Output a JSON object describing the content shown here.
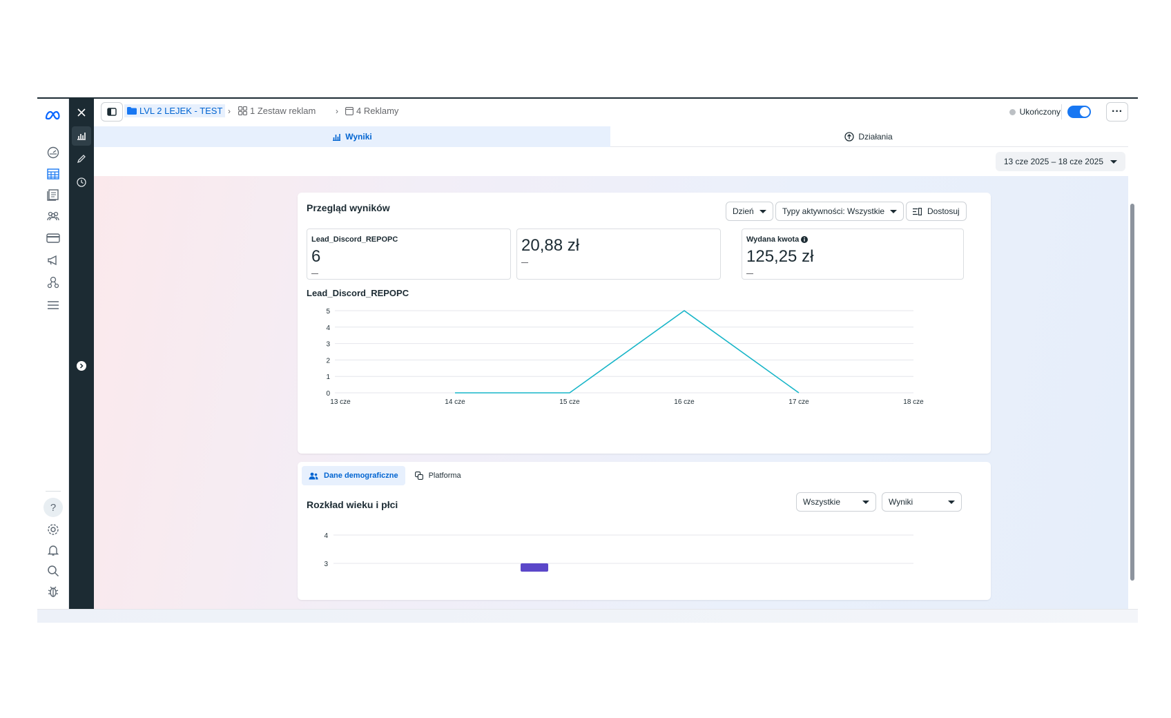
{
  "topbar": {
    "breadcrumbs": [
      {
        "label": "LVL 2 LEJEK - TEST",
        "icon": "folder-icon"
      },
      {
        "label": "1 Zestaw reklam",
        "icon": "grid-icon"
      },
      {
        "label": "4 Reklamy",
        "icon": "ad-icon"
      }
    ],
    "status": "Ukończony",
    "toggle_on": true,
    "more": "···"
  },
  "tabs": [
    {
      "label": "Wyniki",
      "icon": "bar-chart-icon",
      "active": true
    },
    {
      "label": "Działania",
      "icon": "upload-circle-icon",
      "active": false
    }
  ],
  "date_range": "13 cze 2025 – 18 cze 2025",
  "overview": {
    "title": "Przegląd wyników",
    "day_select": "Dzień",
    "activity_select": "Typy aktywności: Wszystkie",
    "customize": "Dostosuj",
    "metrics": [
      {
        "label": "Lead_Discord_REPOPC",
        "value": "6",
        "info": false
      },
      {
        "label": "",
        "value": "20,88 zł",
        "info": false
      },
      {
        "label": "Wydana kwota",
        "value": "125,25 zł",
        "info": true
      }
    ],
    "chart_title": "Lead_Discord_REPOPC"
  },
  "chart_data": [
    {
      "type": "line",
      "title": "Lead_Discord_REPOPC",
      "categories": [
        "13 cze",
        "14 cze",
        "15 cze",
        "16 cze",
        "17 cze",
        "18 cze"
      ],
      "series": [
        {
          "values": [
            null,
            0,
            0,
            5,
            0,
            null
          ],
          "color": "#17b5c8"
        }
      ],
      "yticks": [
        "0",
        "1",
        "2",
        "3",
        "4",
        "5"
      ],
      "ylim": [
        0,
        5
      ],
      "grid": true
    }
  ],
  "demographics": {
    "tabs": [
      {
        "label": "Dane demograficzne",
        "icon": "people-icon",
        "active": true
      },
      {
        "label": "Platforma",
        "icon": "platform-icon",
        "active": false
      }
    ],
    "title": "Rozkład wieku i płci",
    "filter_all": "Wszystkie",
    "filter_results": "Wyniki",
    "yticks": [
      "4",
      "3"
    ],
    "bar_color": "#5b47c9"
  },
  "colors": {
    "accent": "#1877f2",
    "dark_panel": "#1c2b33",
    "line": "#17b5c8"
  }
}
